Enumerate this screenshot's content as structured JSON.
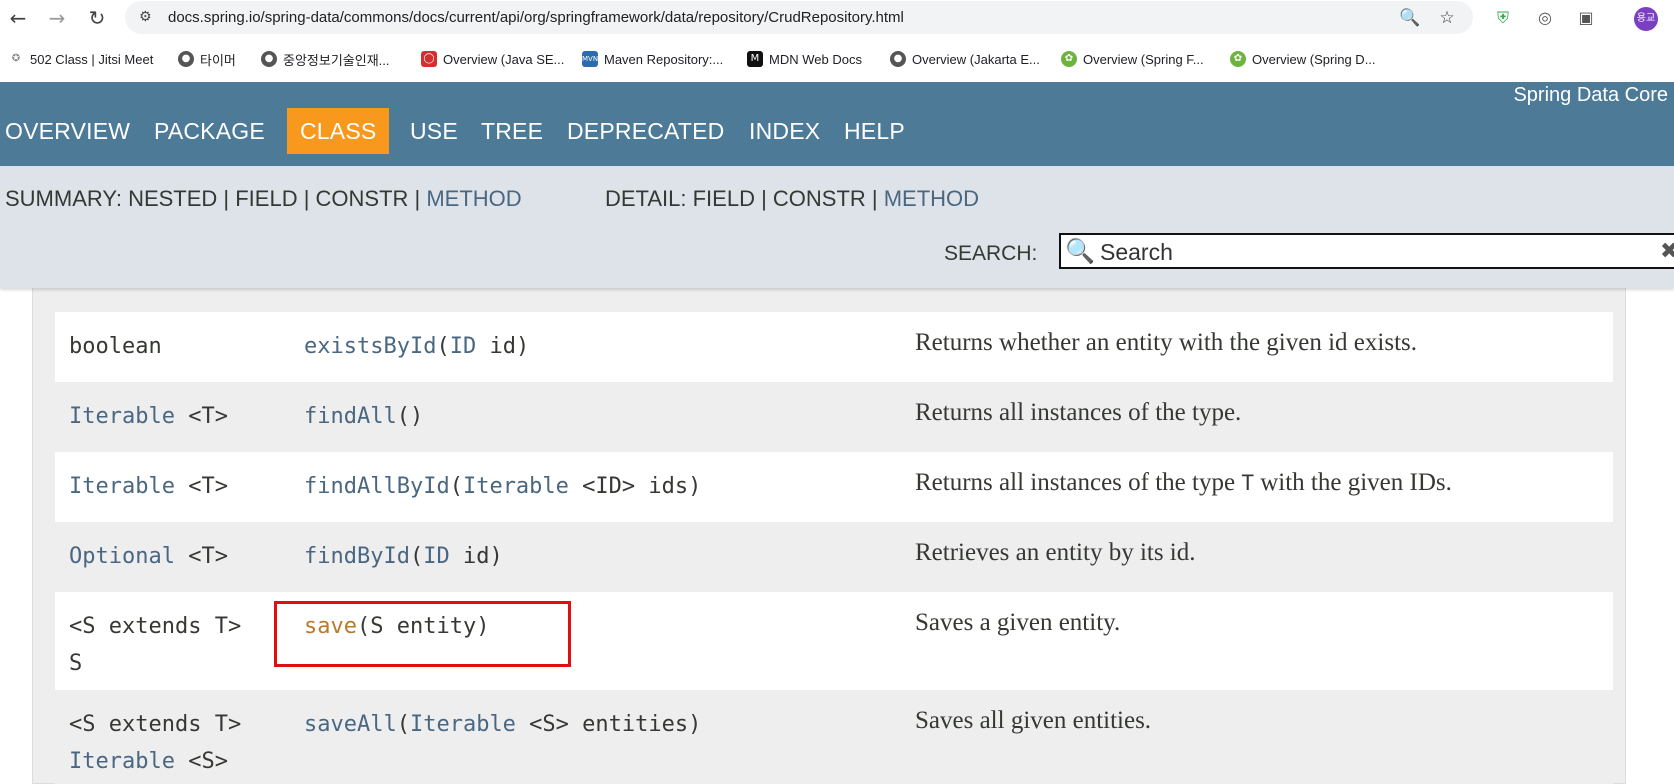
{
  "browser": {
    "url": "docs.spring.io/spring-data/commons/docs/current/api/org/springframework/data/repository/CrudRepository.html",
    "avatar_text": "용교",
    "bookmarks": [
      {
        "label": "502 Class | Jitsi Meet",
        "icon": "jitsi-icon"
      },
      {
        "label": "타이머",
        "icon": "globe-icon"
      },
      {
        "label": "중앙정보기술인재...",
        "icon": "globe-icon"
      },
      {
        "label": "Overview (Java SE...",
        "icon": "oracle-icon"
      },
      {
        "label": "Maven Repository:...",
        "icon": "maven-icon"
      },
      {
        "label": "MDN Web Docs",
        "icon": "mdn-icon"
      },
      {
        "label": "Overview (Jakarta E...",
        "icon": "globe-icon"
      },
      {
        "label": "Overview (Spring F...",
        "icon": "spring-icon"
      },
      {
        "label": "Overview (Spring D...",
        "icon": "spring-icon"
      }
    ]
  },
  "nav": {
    "items": [
      "OVERVIEW",
      "PACKAGE",
      "CLASS",
      "USE",
      "TREE",
      "DEPRECATED",
      "INDEX",
      "HELP"
    ],
    "active": "CLASS",
    "about": "Spring Data Core"
  },
  "subnav": {
    "summary_prefix": "SUMMARY: NESTED | FIELD | CONSTR | ",
    "summary_method": "METHOD",
    "detail_prefix": "DETAIL: FIELD | CONSTR | ",
    "detail_method": "METHOD",
    "search_label": "SEARCH:",
    "search_placeholder": "Search"
  },
  "methods": [
    {
      "type_pre": "boolean",
      "type_link": "",
      "type_post": "",
      "name": "existsById",
      "params_pre": "(",
      "params_link": "ID",
      "params_post": " id)",
      "desc_pre": "Returns whether an entity with the given id exists.",
      "desc_code": "",
      "desc_post": ""
    },
    {
      "type_pre": "",
      "type_link": "Iterable",
      "type_post": " <T>",
      "name": "findAll",
      "params_pre": "()",
      "params_link": "",
      "params_post": "",
      "desc_pre": "Returns all instances of the type.",
      "desc_code": "",
      "desc_post": ""
    },
    {
      "type_pre": "",
      "type_link": "Iterable",
      "type_post": " <T>",
      "name": "findAllById",
      "params_pre": "(",
      "params_link": "Iterable",
      "params_post": " <ID> ids)",
      "desc_pre": "Returns all instances of the type ",
      "desc_code": "T",
      "desc_post": " with the given IDs."
    },
    {
      "type_pre": "",
      "type_link": "Optional",
      "type_post": " <T>",
      "name": "findById",
      "params_pre": "(",
      "params_link": "ID",
      "params_post": " id)",
      "desc_pre": "Retrieves an entity by its id.",
      "desc_code": "",
      "desc_post": ""
    },
    {
      "type_pre": "<S extends T>",
      "type_link": "",
      "type_post": "",
      "type_line2": "S",
      "name": "save",
      "params_pre": "(S entity)",
      "params_link": "",
      "params_post": "",
      "desc_pre": "Saves a given entity.",
      "desc_code": "",
      "desc_post": ""
    },
    {
      "type_pre": "<S extends T>",
      "type_link": "",
      "type_post": "",
      "type_line2_link": "Iterable",
      "type_line2_post": " <S>",
      "name": "saveAll",
      "params_pre": "(",
      "params_link": "Iterable",
      "params_post": " <S> entities)",
      "desc_pre": "Saves all given entities.",
      "desc_code": "",
      "desc_post": ""
    }
  ]
}
